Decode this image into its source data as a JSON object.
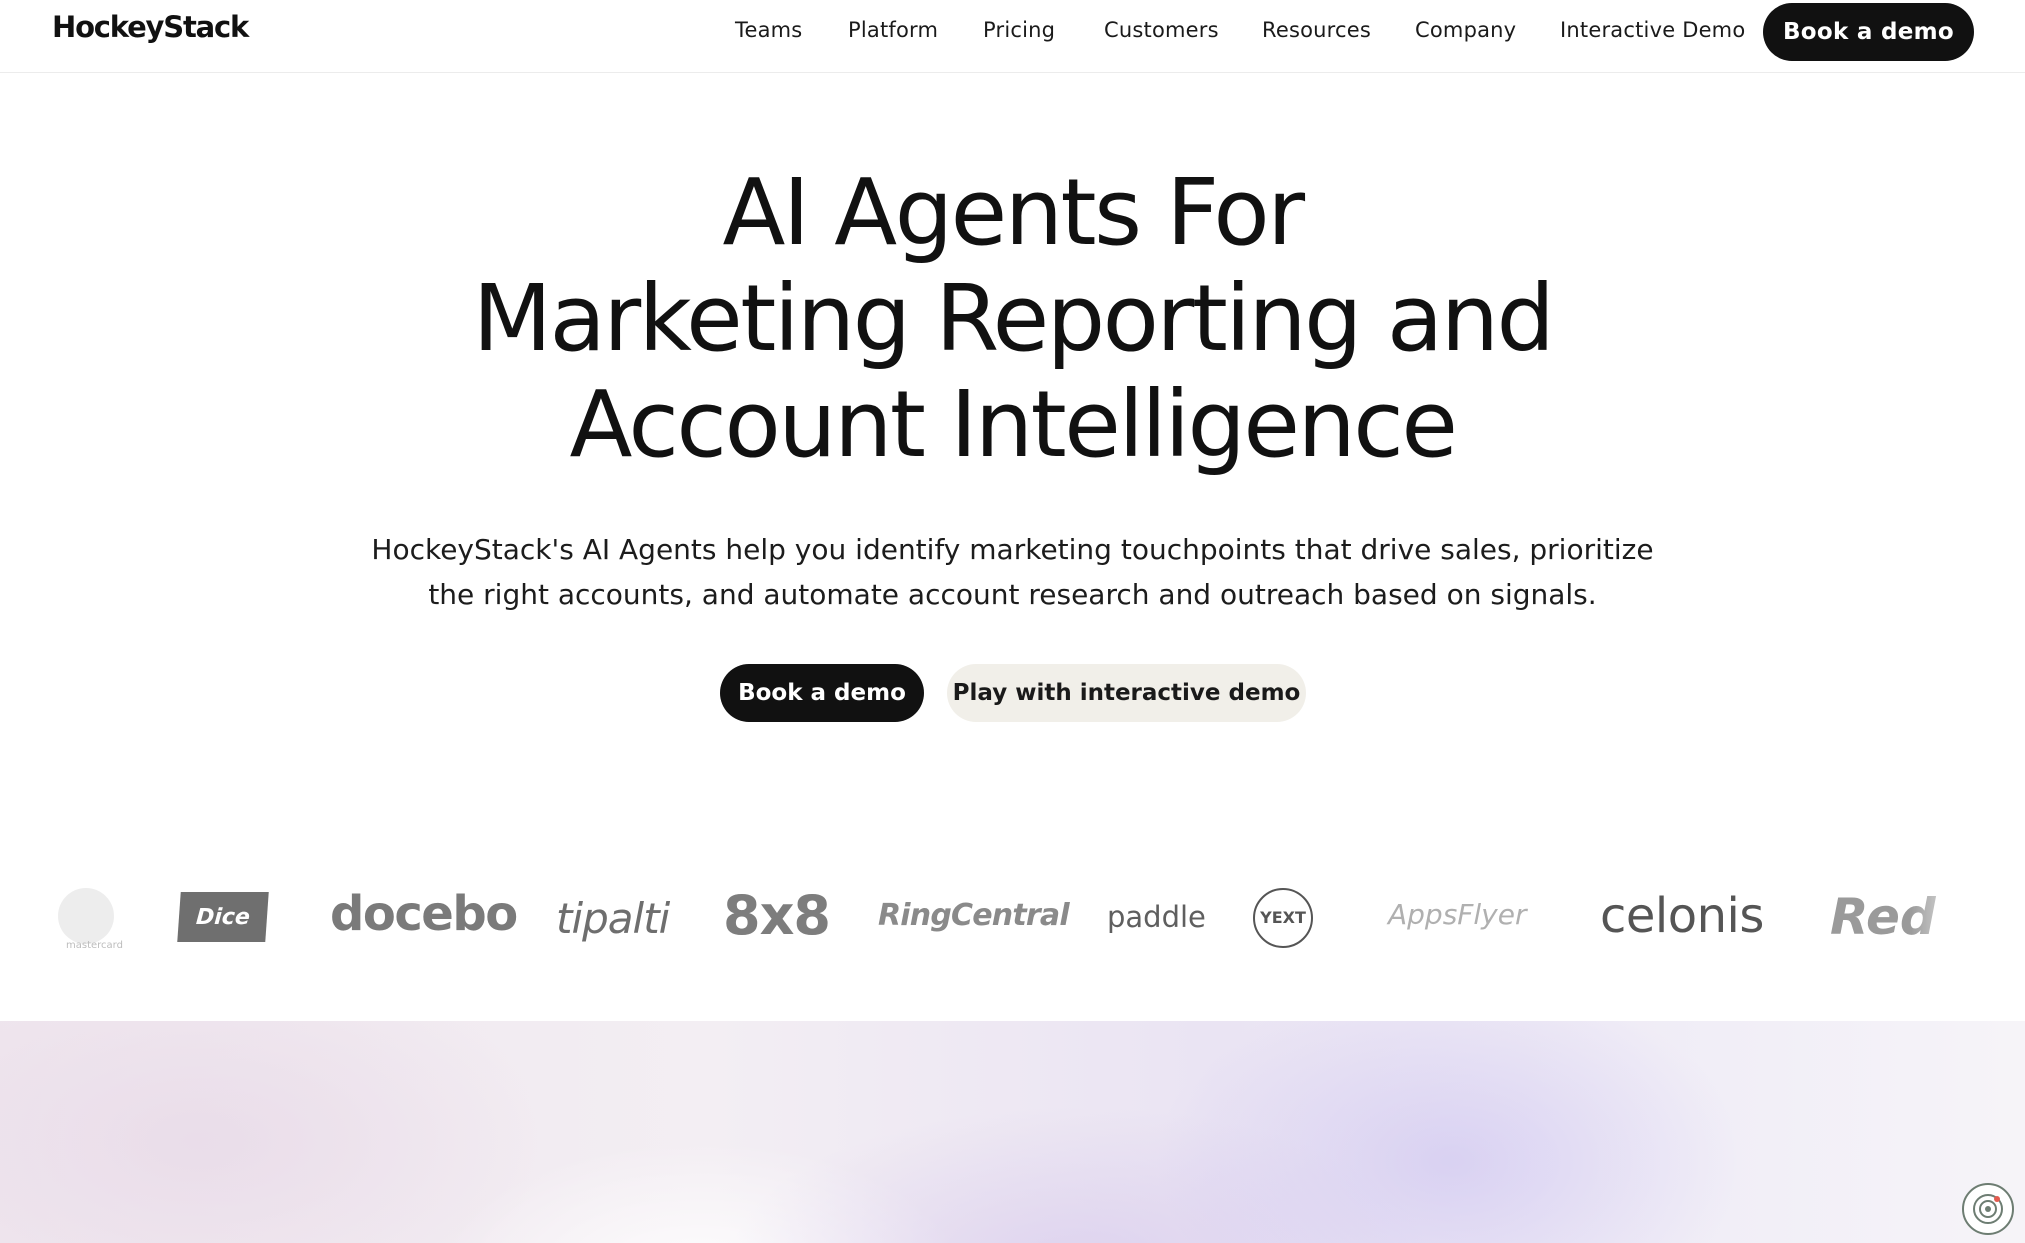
{
  "header": {
    "logo": "HockeyStack",
    "nav": [
      "Teams",
      "Platform",
      "Pricing",
      "Customers",
      "Resources",
      "Company",
      "Interactive Demo"
    ],
    "cta": "Book a demo"
  },
  "hero": {
    "title_lines": [
      "AI Agents For",
      "Marketing Reporting and",
      "Account Intelligence"
    ],
    "subtitle_lines": [
      "HockeyStack's AI Agents help you identify marketing touchpoints that drive sales, prioritize",
      "the right accounts, and automate account research and outreach based on signals."
    ],
    "primary_button": "Book a demo",
    "secondary_button": "Play with interactive demo"
  },
  "logos": {
    "mastercard_label": "mastercard",
    "items": [
      "Dice",
      "docebo",
      "tipalti",
      "8x8",
      "RingCentral",
      "paddle",
      "YE XT",
      "AppsFlyer",
      "celonis",
      "Red"
    ]
  },
  "colors": {
    "text": "#111111",
    "primary_button": "#111111",
    "secondary_button": "#f1efe9",
    "background": "#ffffff"
  },
  "icons": {
    "widget": "chat-support-icon"
  }
}
